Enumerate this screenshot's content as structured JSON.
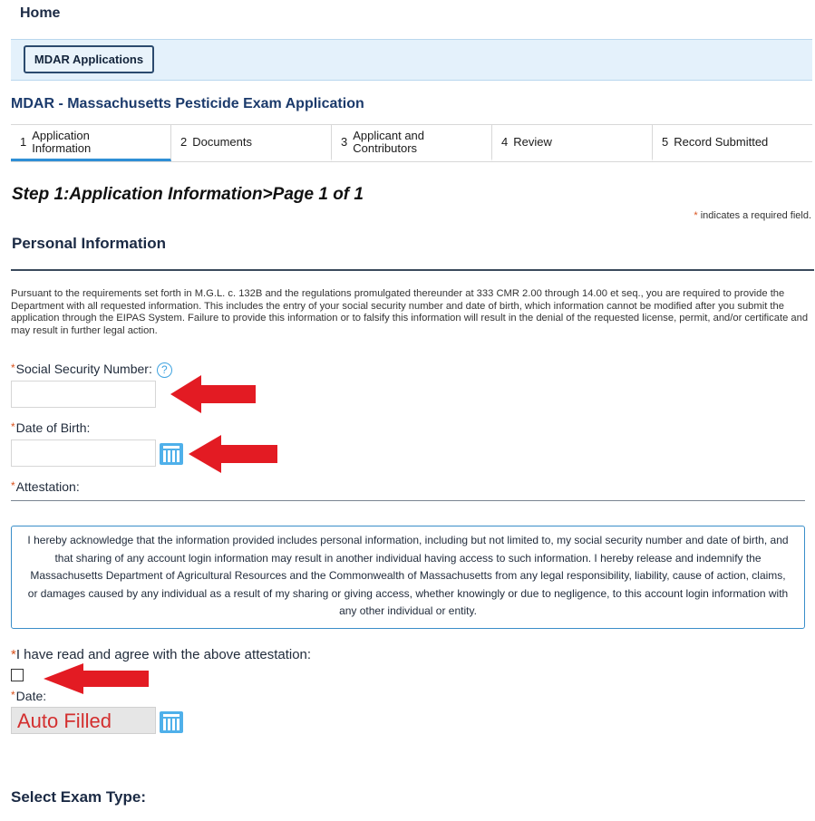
{
  "nav": {
    "home_label": "Home"
  },
  "apps_bar": {
    "button_label": "MDAR Applications"
  },
  "app_title": "MDAR - Massachusetts Pesticide Exam Application",
  "steps": [
    {
      "num": "1",
      "label": "Application\nInformation",
      "active": true
    },
    {
      "num": "2",
      "label": "Documents",
      "active": false
    },
    {
      "num": "3",
      "label": "Applicant and\nContributors",
      "active": false
    },
    {
      "num": "4",
      "label": "Review",
      "active": false
    },
    {
      "num": "5",
      "label": "Record Submitted",
      "active": false
    }
  ],
  "step_heading": "Step 1:Application Information>Page 1 of 1",
  "required_note": {
    "star": "*",
    "text": "indicates a required field."
  },
  "section_title": "Personal Information",
  "intro_text": "Pursuant to the requirements set forth in M.G.L. c. 132B and the regulations promulgated thereunder at 333 CMR 2.00 through 14.00 et seq., you are required to provide the Department with all requested information. This includes the entry of your social security number and date of birth, which information cannot be modified after you submit the application through the EIPAS System. Failure to provide this information or to falsify this information will result in the denial of the requested license, permit, and/or certificate and may result in further legal action.",
  "fields": {
    "ssn_label": "Social Security Number:",
    "ssn_value": "",
    "help_glyph": "?",
    "dob_label": "Date of Birth:",
    "dob_value": "",
    "attestation_label": "Attestation:",
    "agree_label": "I have read and agree with the above attestation:",
    "date_label": "Date:",
    "date_value": "Auto Filled"
  },
  "attestation_text": "I hereby acknowledge that the information provided includes personal information, including but not limited to, my social security number and date of birth, and that sharing of any account login information may result in another individual having access to such information. I hereby release and indemnify the Massachusetts Department of Agricultural Resources and the Commonwealth of Massachusetts from any legal responsibility, liability, cause of action, claims, or damages caused by any individual as a result of my sharing or giving access, whether knowingly or due to negligence, to this account login information with any other individual or entity.",
  "exam_section_title": "Select Exam Type:",
  "colors": {
    "accent": "#2f8fd6",
    "required": "#d9531e",
    "annotation_arrow": "#e31b23",
    "auto_filled_text": "#d32f2f"
  },
  "icons": [
    "help-icon",
    "calendar-icon",
    "annotation-arrow"
  ]
}
